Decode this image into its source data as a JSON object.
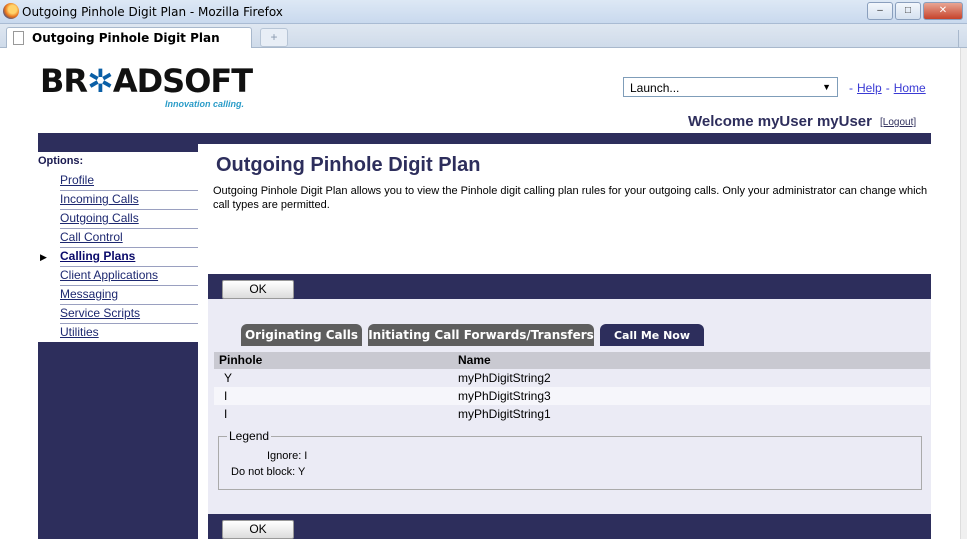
{
  "window": {
    "title": "Outgoing Pinhole Digit Plan - Mozilla Firefox",
    "buttons": {
      "minimize": "–",
      "maximize": "□",
      "close": "✕"
    }
  },
  "browser": {
    "tab_title": "Outgoing Pinhole Digit Plan",
    "new_tab": "+"
  },
  "header": {
    "logo_left": "BR",
    "logo_star": "✲",
    "logo_right": "ADSOFT",
    "tagline": "Innovation calling.",
    "launch": {
      "value": "Launch...",
      "arrow": "▼"
    },
    "links": {
      "dash1": "-",
      "help": "Help",
      "dash2": "-",
      "home": "Home"
    },
    "welcome": "Welcome myUser myUser",
    "logout": "[Logout]"
  },
  "sidebar": {
    "title": "Options:",
    "bullet": "▶",
    "items": [
      {
        "label": "Profile"
      },
      {
        "label": "Incoming Calls"
      },
      {
        "label": "Outgoing Calls"
      },
      {
        "label": "Call Control"
      },
      {
        "label": "Calling Plans",
        "active": true
      },
      {
        "label": "Client Applications"
      },
      {
        "label": "Messaging"
      },
      {
        "label": "Service Scripts"
      },
      {
        "label": "Utilities"
      }
    ]
  },
  "main": {
    "title": "Outgoing Pinhole Digit Plan",
    "description": "Outgoing Pinhole Digit Plan allows you to view the Pinhole digit calling plan rules for your outgoing calls. Only your administrator can change which call types are permitted.",
    "ok_label": "OK",
    "tabs": [
      {
        "label": "Originating Calls"
      },
      {
        "label": "Initiating Call Forwards/Transfers"
      },
      {
        "label": "Call Me Now",
        "active": true
      }
    ],
    "table": {
      "headers": {
        "pinhole": "Pinhole",
        "name": "Name"
      },
      "rows": [
        {
          "pinhole": "Y",
          "name": "myPhDigitString2"
        },
        {
          "pinhole": "I",
          "name": "myPhDigitString3"
        },
        {
          "pinhole": "I",
          "name": "myPhDigitString1"
        }
      ]
    },
    "legend": {
      "title": "Legend",
      "ignore": "Ignore: I",
      "do_not_block": "Do not block: Y"
    }
  },
  "colors": {
    "navy": "#2d2e5c",
    "tab_inactive": "#5e5e5e",
    "panel_bg": "#ebebf5",
    "link": "#3a3ad4"
  }
}
